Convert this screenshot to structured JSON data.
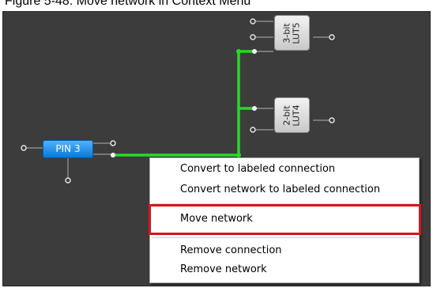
{
  "figure_caption": "Figure 5-48: Move network in Context Menu",
  "canvas": {
    "blocks": {
      "lut5": {
        "line1": "3-bit",
        "line2": "LUT5"
      },
      "lut4": {
        "line1": "2-bit",
        "line2": "LUT4"
      },
      "pin": {
        "label": "PIN 3"
      }
    }
  },
  "context_menu": {
    "items": [
      {
        "label": "Convert to labeled connection"
      },
      {
        "label": "Convert network to labeled connection"
      },
      {
        "label": "Move network",
        "highlighted": true
      },
      {
        "label": "Remove connection"
      },
      {
        "label": "Remove network"
      }
    ]
  },
  "colors": {
    "canvas_background": "#3c3c3c",
    "active_wire": "#22dd22",
    "pin_block": "#1e8ee8",
    "highlight_border": "#d9141b"
  }
}
